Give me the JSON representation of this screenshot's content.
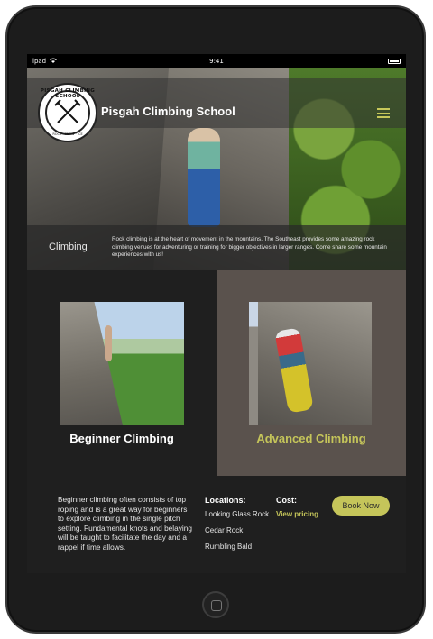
{
  "status": {
    "carrier": "ipad",
    "time": "9:41"
  },
  "brand": {
    "title": "Pisgah Climbing School",
    "logo_ring_text": "PISGAH CLIMBING SCHOOL",
    "logo_sub_text": "ROCK · SNOW · ICE"
  },
  "intro": {
    "label": "Climbing",
    "text": "Rock climbing is at the heart of movement in the mountains. The Southeast provides some amazing rock climbing venues for adventuring or training for bigger objectives in larger ranges. Come share some mountain experiences with us!"
  },
  "cards": [
    {
      "title": "Beginner Climbing"
    },
    {
      "title": "Advanced Climbing"
    }
  ],
  "detail": {
    "description": "Beginner climbing often consists of top roping and is a great way for beginners to explore climbing in the single pitch setting. Fundamental knots and belaying will be taught to facilitate the day and a rappel if time allows.",
    "locations_heading": "Locations:",
    "locations": [
      "Looking Glass Rock",
      "Cedar Rock",
      "Rumbling Bald"
    ],
    "cost_heading": "Cost:",
    "cost_link": "View pricing",
    "book_label": "Book Now"
  },
  "colors": {
    "accent": "#c5c55a",
    "dark": "#1f1f1f",
    "card_selected": "#5a524d"
  },
  "icons": [
    "wifi-icon",
    "battery-icon",
    "menu-icon",
    "ice-axe-logo-icon"
  ]
}
